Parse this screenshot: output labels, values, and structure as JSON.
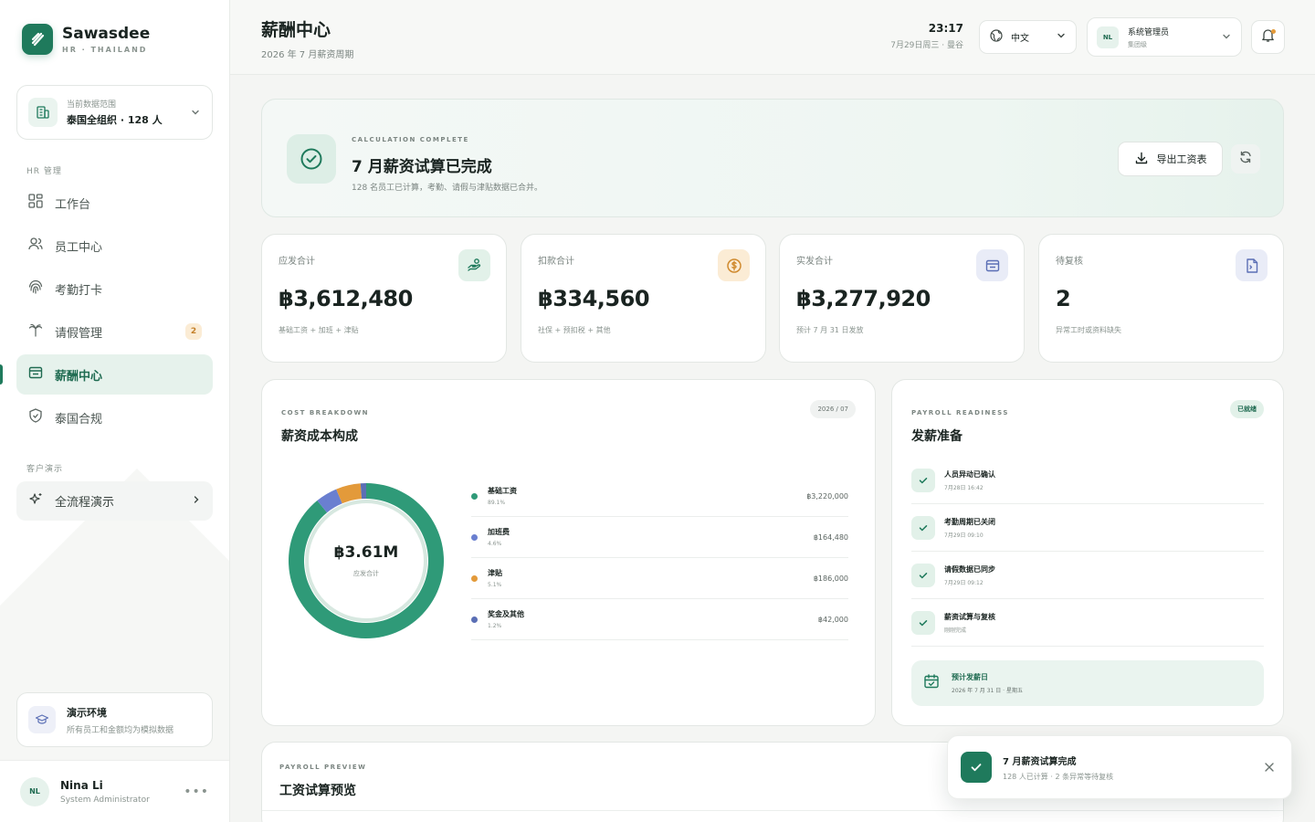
{
  "brand": {
    "name": "Sawasdee",
    "tagline": "HR · THAILAND"
  },
  "scope": {
    "label": "当前数据范围",
    "value": "泰国全组织 · 128 人"
  },
  "sidebar": {
    "section_hr": "HR 管理",
    "items": [
      {
        "label": "工作台",
        "icon": "grid-icon"
      },
      {
        "label": "员工中心",
        "icon": "users-icon"
      },
      {
        "label": "考勤打卡",
        "icon": "fingerprint-icon"
      },
      {
        "label": "请假管理",
        "icon": "palm-tree-icon",
        "badge": "2"
      },
      {
        "label": "薪酬中心",
        "icon": "wallet-icon",
        "active": true
      },
      {
        "label": "泰国合规",
        "icon": "shield-icon"
      }
    ],
    "section_demo": "客户演示",
    "demo_item": "全流程演示"
  },
  "env": {
    "title": "演示环境",
    "subtitle": "所有员工和金额均为模拟数据"
  },
  "current_user": {
    "initials": "NL",
    "name": "Nina Li",
    "role": "System Administrator"
  },
  "header": {
    "title": "薪酬中心",
    "subtitle": "2026 年 7 月薪资周期",
    "time": "23:17",
    "date": "7月29日周三 · 曼谷",
    "language": "中文",
    "user_initials": "NL",
    "user_role": "系统管理员",
    "user_sub": "集团级"
  },
  "banner": {
    "kicker": "CALCULATION COMPLETE",
    "title": "7 月薪资试算已完成",
    "desc": "128 名员工已计算，考勤、请假与津贴数据已合并。",
    "export_label": "导出工资表"
  },
  "stats": [
    {
      "label": "应发合计",
      "value": "฿3,612,480",
      "sub": "基础工资 + 加班 + 津贴",
      "icon": "hand-coins-icon",
      "color": "#1f7a5c"
    },
    {
      "label": "扣款合计",
      "value": "฿334,560",
      "sub": "社保 + 预扣税 + 其他",
      "icon": "coin-icon",
      "color": "#d08a2e"
    },
    {
      "label": "实发合计",
      "value": "฿3,277,920",
      "sub": "预计 7 月 31 日发放",
      "icon": "wallet-icon",
      "color": "#5b6fb5"
    },
    {
      "label": "待复核",
      "value": "2",
      "sub": "异常工时或资料缺失",
      "icon": "file-icon",
      "color": "#5b6fb5"
    }
  ],
  "cost": {
    "kicker": "COST BREAKDOWN",
    "title": "薪资成本构成",
    "period": "2026 / 07",
    "total": "฿3.61M",
    "total_label": "应发合计"
  },
  "chart_data": {
    "type": "pie",
    "title": "薪资成本构成",
    "categories": [
      "基础工资",
      "加班费",
      "津贴",
      "奖金及其他"
    ],
    "values": [
      3220000,
      164480,
      186000,
      42000
    ],
    "percent_labels": [
      "89.1%",
      "4.6%",
      "5.1%",
      "1.2%"
    ],
    "amount_labels": [
      "฿3,220,000",
      "฿164,480",
      "฿186,000",
      "฿42,000"
    ],
    "colors": [
      "#2f9a78",
      "#6a7fd0",
      "#e39a3a",
      "#5b6fb5"
    ],
    "center_value": "฿3.61M",
    "center_label": "应发合计"
  },
  "readiness": {
    "kicker": "PAYROLL READINESS",
    "title": "发薪准备",
    "status": "已就绪",
    "items": [
      {
        "title": "人员异动已确认",
        "time": "7月28日 16:42"
      },
      {
        "title": "考勤周期已关闭",
        "time": "7月29日 09:10"
      },
      {
        "title": "请假数据已同步",
        "time": "7月29日 09:12"
      },
      {
        "title": "薪资试算与复核",
        "time": "刚刚完成"
      }
    ],
    "payday_title": "预计发薪日",
    "payday_date": "2026 年 7 月 31 日 · 星期五"
  },
  "preview": {
    "kicker": "PAYROLL PREVIEW",
    "title": "工资试算预览"
  },
  "toast": {
    "title": "7 月薪资试算完成",
    "subtitle": "128 人已计算 · 2 条异常等待复核"
  }
}
